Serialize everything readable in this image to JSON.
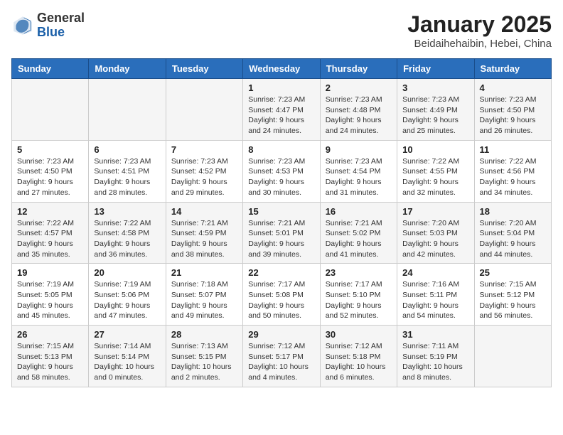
{
  "header": {
    "logo_general": "General",
    "logo_blue": "Blue",
    "month_title": "January 2025",
    "location": "Beidaihehaibin, Hebei, China"
  },
  "weekdays": [
    "Sunday",
    "Monday",
    "Tuesday",
    "Wednesday",
    "Thursday",
    "Friday",
    "Saturday"
  ],
  "weeks": [
    [
      {
        "day": "",
        "info": ""
      },
      {
        "day": "",
        "info": ""
      },
      {
        "day": "",
        "info": ""
      },
      {
        "day": "1",
        "info": "Sunrise: 7:23 AM\nSunset: 4:47 PM\nDaylight: 9 hours and 24 minutes."
      },
      {
        "day": "2",
        "info": "Sunrise: 7:23 AM\nSunset: 4:48 PM\nDaylight: 9 hours and 24 minutes."
      },
      {
        "day": "3",
        "info": "Sunrise: 7:23 AM\nSunset: 4:49 PM\nDaylight: 9 hours and 25 minutes."
      },
      {
        "day": "4",
        "info": "Sunrise: 7:23 AM\nSunset: 4:50 PM\nDaylight: 9 hours and 26 minutes."
      }
    ],
    [
      {
        "day": "5",
        "info": "Sunrise: 7:23 AM\nSunset: 4:50 PM\nDaylight: 9 hours and 27 minutes."
      },
      {
        "day": "6",
        "info": "Sunrise: 7:23 AM\nSunset: 4:51 PM\nDaylight: 9 hours and 28 minutes."
      },
      {
        "day": "7",
        "info": "Sunrise: 7:23 AM\nSunset: 4:52 PM\nDaylight: 9 hours and 29 minutes."
      },
      {
        "day": "8",
        "info": "Sunrise: 7:23 AM\nSunset: 4:53 PM\nDaylight: 9 hours and 30 minutes."
      },
      {
        "day": "9",
        "info": "Sunrise: 7:23 AM\nSunset: 4:54 PM\nDaylight: 9 hours and 31 minutes."
      },
      {
        "day": "10",
        "info": "Sunrise: 7:22 AM\nSunset: 4:55 PM\nDaylight: 9 hours and 32 minutes."
      },
      {
        "day": "11",
        "info": "Sunrise: 7:22 AM\nSunset: 4:56 PM\nDaylight: 9 hours and 34 minutes."
      }
    ],
    [
      {
        "day": "12",
        "info": "Sunrise: 7:22 AM\nSunset: 4:57 PM\nDaylight: 9 hours and 35 minutes."
      },
      {
        "day": "13",
        "info": "Sunrise: 7:22 AM\nSunset: 4:58 PM\nDaylight: 9 hours and 36 minutes."
      },
      {
        "day": "14",
        "info": "Sunrise: 7:21 AM\nSunset: 4:59 PM\nDaylight: 9 hours and 38 minutes."
      },
      {
        "day": "15",
        "info": "Sunrise: 7:21 AM\nSunset: 5:01 PM\nDaylight: 9 hours and 39 minutes."
      },
      {
        "day": "16",
        "info": "Sunrise: 7:21 AM\nSunset: 5:02 PM\nDaylight: 9 hours and 41 minutes."
      },
      {
        "day": "17",
        "info": "Sunrise: 7:20 AM\nSunset: 5:03 PM\nDaylight: 9 hours and 42 minutes."
      },
      {
        "day": "18",
        "info": "Sunrise: 7:20 AM\nSunset: 5:04 PM\nDaylight: 9 hours and 44 minutes."
      }
    ],
    [
      {
        "day": "19",
        "info": "Sunrise: 7:19 AM\nSunset: 5:05 PM\nDaylight: 9 hours and 45 minutes."
      },
      {
        "day": "20",
        "info": "Sunrise: 7:19 AM\nSunset: 5:06 PM\nDaylight: 9 hours and 47 minutes."
      },
      {
        "day": "21",
        "info": "Sunrise: 7:18 AM\nSunset: 5:07 PM\nDaylight: 9 hours and 49 minutes."
      },
      {
        "day": "22",
        "info": "Sunrise: 7:17 AM\nSunset: 5:08 PM\nDaylight: 9 hours and 50 minutes."
      },
      {
        "day": "23",
        "info": "Sunrise: 7:17 AM\nSunset: 5:10 PM\nDaylight: 9 hours and 52 minutes."
      },
      {
        "day": "24",
        "info": "Sunrise: 7:16 AM\nSunset: 5:11 PM\nDaylight: 9 hours and 54 minutes."
      },
      {
        "day": "25",
        "info": "Sunrise: 7:15 AM\nSunset: 5:12 PM\nDaylight: 9 hours and 56 minutes."
      }
    ],
    [
      {
        "day": "26",
        "info": "Sunrise: 7:15 AM\nSunset: 5:13 PM\nDaylight: 9 hours and 58 minutes."
      },
      {
        "day": "27",
        "info": "Sunrise: 7:14 AM\nSunset: 5:14 PM\nDaylight: 10 hours and 0 minutes."
      },
      {
        "day": "28",
        "info": "Sunrise: 7:13 AM\nSunset: 5:15 PM\nDaylight: 10 hours and 2 minutes."
      },
      {
        "day": "29",
        "info": "Sunrise: 7:12 AM\nSunset: 5:17 PM\nDaylight: 10 hours and 4 minutes."
      },
      {
        "day": "30",
        "info": "Sunrise: 7:12 AM\nSunset: 5:18 PM\nDaylight: 10 hours and 6 minutes."
      },
      {
        "day": "31",
        "info": "Sunrise: 7:11 AM\nSunset: 5:19 PM\nDaylight: 10 hours and 8 minutes."
      },
      {
        "day": "",
        "info": ""
      }
    ]
  ]
}
